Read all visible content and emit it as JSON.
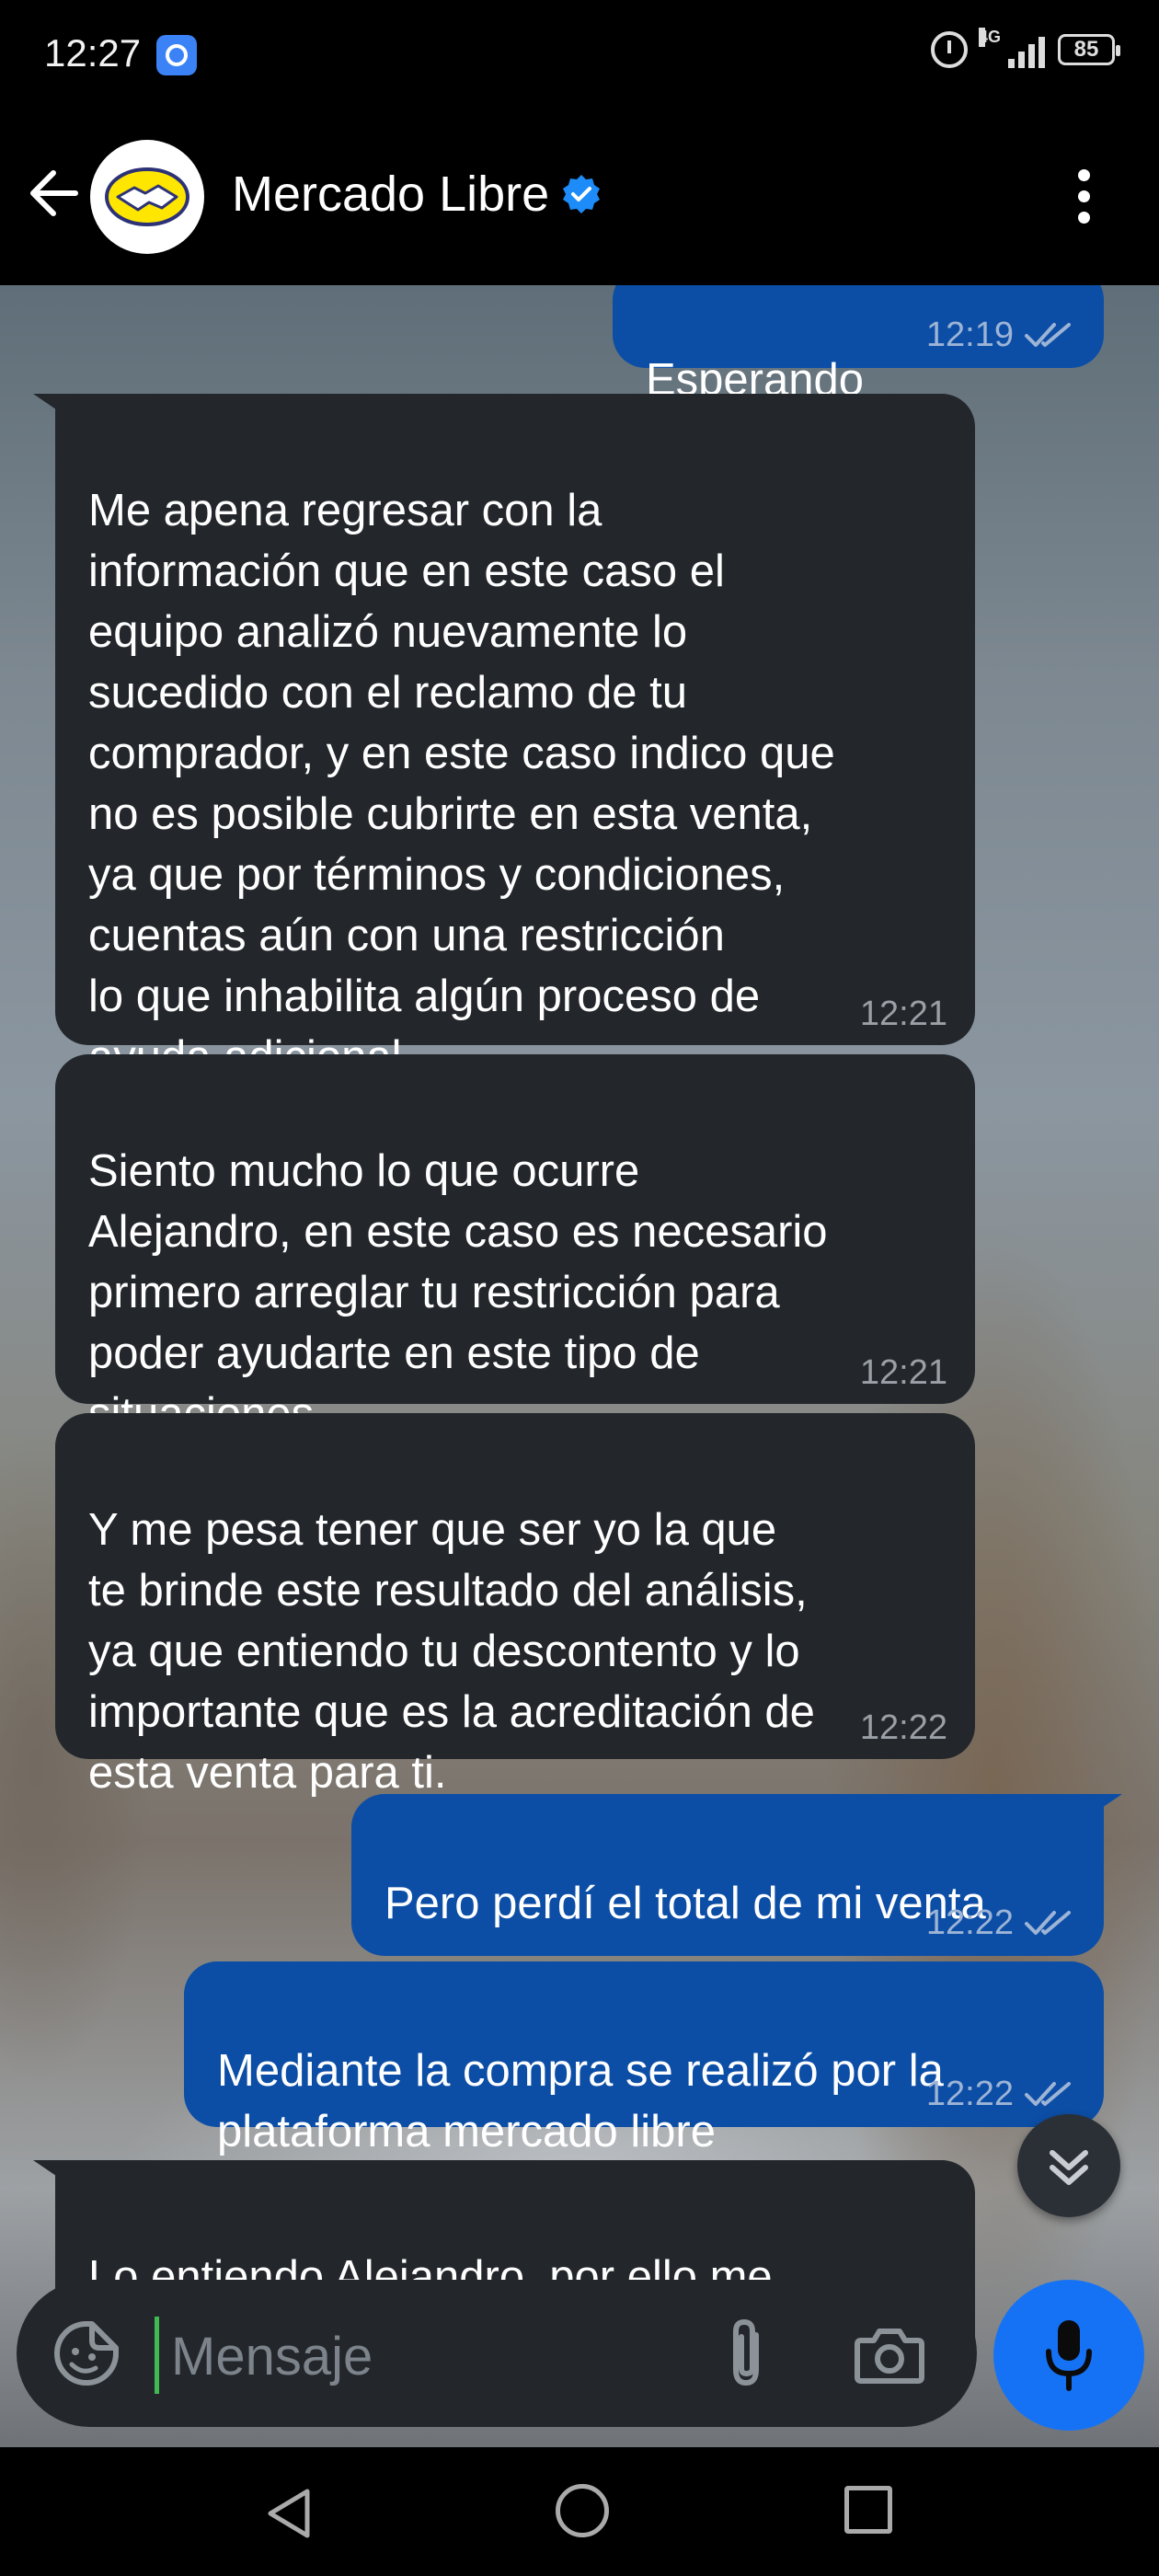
{
  "status_bar": {
    "time": "12:27",
    "network": "4G",
    "battery": "85"
  },
  "header": {
    "title": "Mercado Libre"
  },
  "messages": [
    {
      "direction": "outgoing",
      "text": "Esperando",
      "time": "12:19"
    },
    {
      "direction": "incoming",
      "text": "Me apena regresar con la\ninformación que en este caso el\nequipo analizó nuevamente lo\nsucedido con el reclamo de tu\ncomprador, y en este caso indico que\nno es posible cubrirte en esta venta,\nya que por términos y condiciones,\ncuentas aún con una restricción\nlo que inhabilita algún proceso de\nayuda adicional.",
      "time": "12:21"
    },
    {
      "direction": "incoming",
      "text": "Siento mucho lo que ocurre\nAlejandro, en este caso es necesario\nprimero arreglar tu restricción para\npoder ayudarte en este tipo de\nsituaciones.",
      "time": "12:21"
    },
    {
      "direction": "incoming",
      "text": "Y me pesa tener que ser yo la que\nte brinde este resultado del análisis,\nya que entiendo tu descontento y lo\nimportante que es la acreditación de\nesta venta para ti.",
      "time": "12:22"
    },
    {
      "direction": "outgoing",
      "text": "Pero perdí el total de mi venta",
      "time": "12:22"
    },
    {
      "direction": "outgoing",
      "text": "Mediante la compra se realizó por la\nplataforma mercado libre",
      "time": "12:22"
    },
    {
      "direction": "incoming",
      "text": "Lo entiendo Alejandro, por ello me\napena ser yo quien te indique que",
      "time": ""
    }
  ],
  "composer": {
    "placeholder": "Mensaje"
  },
  "colors": {
    "incoming_bubble": "#23272c",
    "outgoing_bubble": "#0c4ea6",
    "accent": "#1672f5",
    "verified": "#1d8cf8"
  },
  "icons": {
    "back": "back-arrow-icon",
    "verified": "verified-badge-icon",
    "menu": "kebab-menu-icon",
    "emoji": "sticker-emoji-icon",
    "attach": "paperclip-icon",
    "camera": "camera-icon",
    "mic": "microphone-icon",
    "scroll": "double-chevron-down-icon"
  }
}
